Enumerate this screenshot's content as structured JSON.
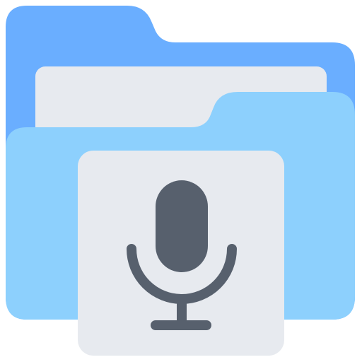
{
  "icon": {
    "name": "audio-folder-icon",
    "parts": {
      "folder_back": "folder-back-icon",
      "paper": "paper-sheet-icon",
      "folder_front": "folder-front-icon",
      "card": "audio-card-icon",
      "mic": "microphone-icon"
    }
  },
  "colors": {
    "folder_back": "#6AAEFF",
    "folder_front": "#8DD0FD",
    "paper": "#E7EAEF",
    "card": "#E7EAEF",
    "mic": "#57606D",
    "background": "#FFFFFF"
  }
}
